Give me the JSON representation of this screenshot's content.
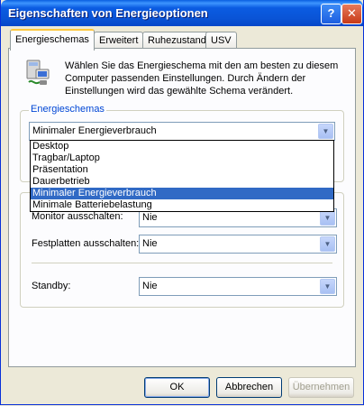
{
  "window": {
    "title": "Eigenschaften von Energieoptionen",
    "help_glyph": "?",
    "close_glyph": "✕"
  },
  "tabs": [
    {
      "label": "Energieschemas",
      "active": true
    },
    {
      "label": "Erweitert",
      "active": false
    },
    {
      "label": "Ruhezustand",
      "active": false
    },
    {
      "label": "USV",
      "active": false
    }
  ],
  "description": "Wählen Sie das Energieschema mit den am besten zu diesem Computer passenden Einstellungen. Durch Ändern der Einstellungen wird das gewählte Schema verändert.",
  "schemes_group": {
    "label": "Energieschemas",
    "selected": "Minimaler Energieverbrauch",
    "options": [
      "Desktop",
      "Tragbar/Laptop",
      "Präsentation",
      "Dauerbetrieb",
      "Minimaler Energieverbrauch",
      "Minimale Batteriebelastung"
    ],
    "highlighted_index": 4
  },
  "settings": {
    "monitor_label": "Monitor ausschalten:",
    "monitor_value": "Nie",
    "disk_label": "Festplatten ausschalten:",
    "disk_value": "Nie",
    "standby_label": "Standby:",
    "standby_value": "Nie"
  },
  "buttons": {
    "ok": "OK",
    "cancel": "Abbrechen",
    "apply": "Übernehmen"
  },
  "colors": {
    "titlebar": "#0a54d6",
    "selection": "#316ac5",
    "group_label": "#0046d5"
  }
}
